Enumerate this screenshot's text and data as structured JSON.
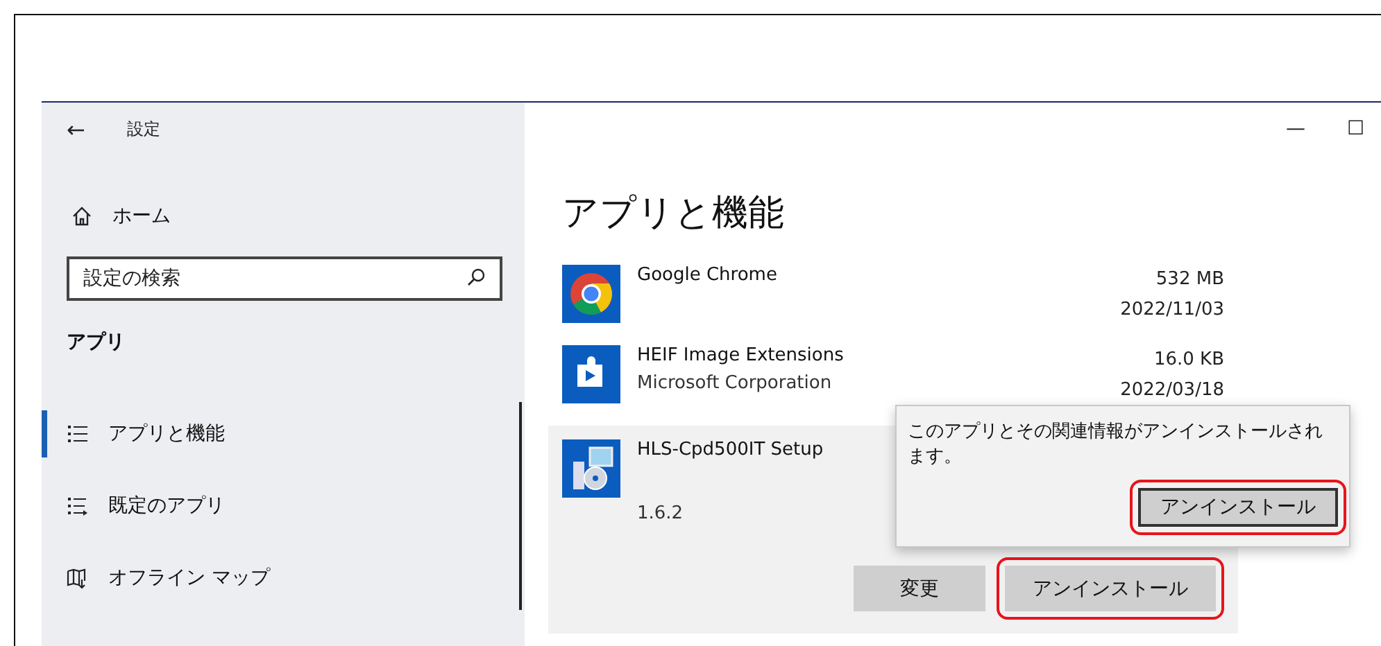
{
  "window": {
    "title": "設定",
    "back": "←",
    "controls": [
      "—",
      "☐"
    ]
  },
  "sidebar": {
    "home": "ホーム",
    "search": {
      "placeholder": "設定の検索"
    },
    "section": "アプリ",
    "items": [
      {
        "label": "アプリと機能",
        "selected": true
      },
      {
        "label": "既定のアプリ",
        "selected": false
      },
      {
        "label": "オフライン マップ",
        "selected": false
      }
    ]
  },
  "main": {
    "title": "アプリと機能",
    "apps": [
      {
        "name": "Google Chrome",
        "size": "532 MB",
        "date": "2022/11/03",
        "selected": false
      },
      {
        "name": "HEIF Image Extensions",
        "publisher": "Microsoft Corporation",
        "size": "16.0 KB",
        "date": "2022/03/18",
        "selected": false
      },
      {
        "name": "HLS-Cpd500IT Setup",
        "version": "1.6.2",
        "selected": true,
        "buttons": [
          {
            "label": "変更",
            "highlighted": false
          },
          {
            "label": "アンインストール",
            "highlighted": true
          }
        ]
      }
    ],
    "flyout": {
      "message": "このアプリとその関連情報がアンインストールされます。",
      "button": {
        "label": "アンインストール",
        "highlighted": true
      }
    }
  }
}
